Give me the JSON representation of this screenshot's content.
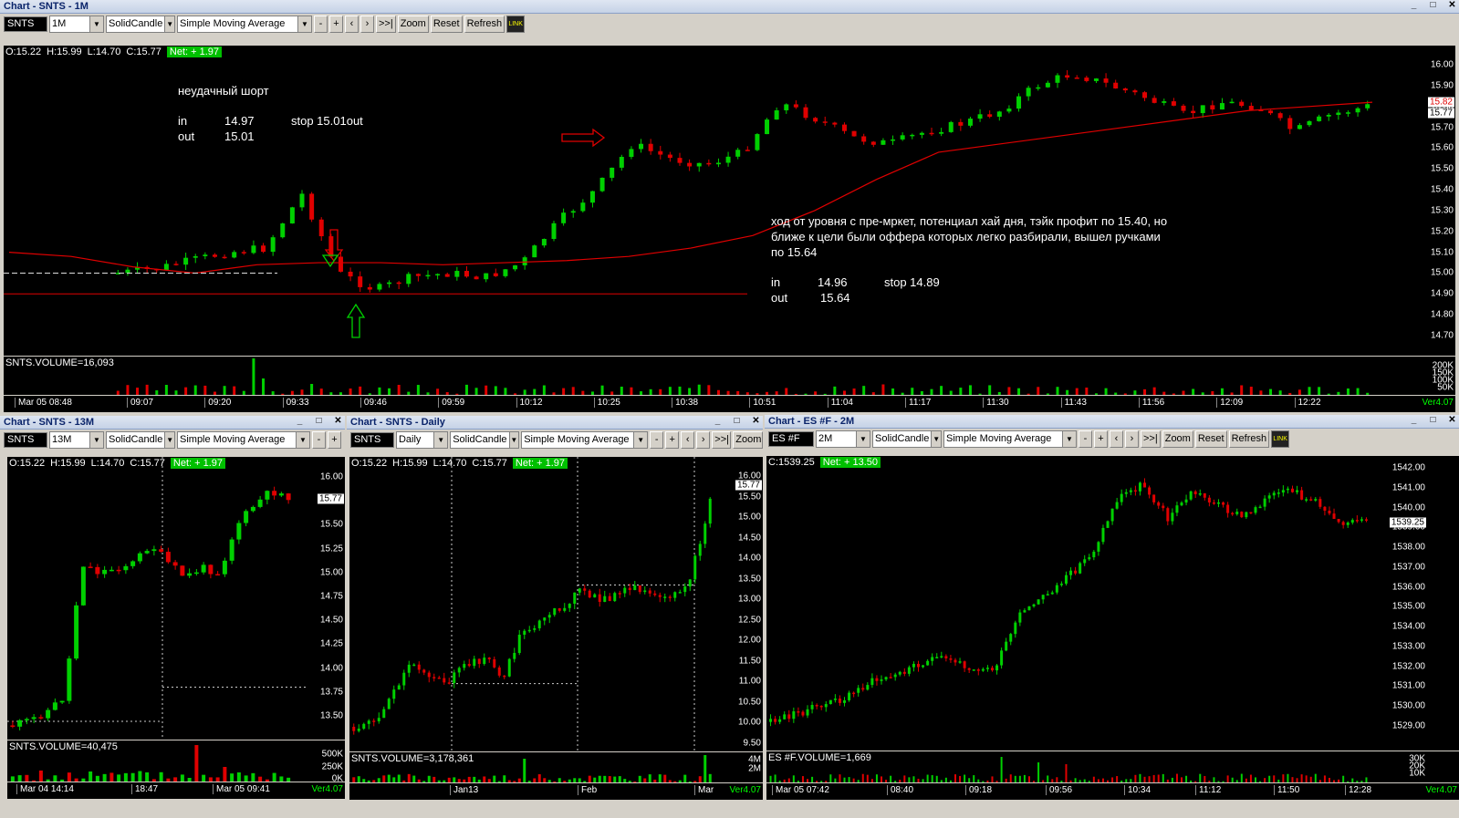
{
  "colors": {
    "up": "#00d000",
    "down": "#e00000",
    "sma": "#e00000",
    "net": "#00c000"
  },
  "top": {
    "title": "Chart - SNTS - 1M",
    "symbol": "SNTS",
    "interval": "1M",
    "candle": "SolidCandle",
    "study": "Simple Moving Average",
    "ohlc": {
      "o": "O:15.22",
      "h": "H:15.99",
      "l": "L:14.70",
      "c": "C:15.77",
      "net": "Net: + 1.97"
    },
    "price_ticks": [
      "16.00",
      "15.90",
      "15.80",
      "15.70",
      "15.60",
      "15.50",
      "15.40",
      "15.30",
      "15.20",
      "15.10",
      "15.00",
      "14.90",
      "14.80",
      "14.70"
    ],
    "last_price": "15.77",
    "sma_price": "15.82",
    "volume_label": "SNTS.VOLUME=16,093",
    "volume_ticks": [
      "200K",
      "150K",
      "100K",
      "50K"
    ],
    "time_labels": [
      "Mar 05 08:48",
      "09:07",
      "09:20",
      "09:33",
      "09:46",
      "09:59",
      "10:12",
      "10:25",
      "10:38",
      "10:51",
      "11:04",
      "11:17",
      "11:30",
      "11:43",
      "11:56",
      "12:09",
      "12:22"
    ],
    "version": "Ver4.07",
    "annotation1": {
      "title": "неудачный шорт",
      "in_label": "in",
      "in_val": "14.97",
      "stop": "stop 15.01out",
      "out_label": "out",
      "out_val": "15.01"
    },
    "annotation2": {
      "line1": "ход от уровня с пре-мркет, потенциал хай дня, тэйк профит по 15.40, но",
      "line2": "ближе к цели были оффера которых легко разбирали, вышел ручками",
      "line3": "по 15.64",
      "in_label": "in",
      "in_val": "14.96",
      "stop": "stop 14.89",
      "out_label": "out",
      "out_val": "15.64"
    }
  },
  "left": {
    "title": "Chart - SNTS - 13M",
    "symbol": "SNTS",
    "interval": "13M",
    "candle": "SolidCandle",
    "study": "Simple Moving Average",
    "ohlc": {
      "o": "O:15.22",
      "h": "H:15.99",
      "l": "L:14.70",
      "c": "C:15.77",
      "net": "Net: + 1.97"
    },
    "price_ticks": [
      "16.00",
      "15.75",
      "15.50",
      "15.25",
      "15.00",
      "14.75",
      "14.50",
      "14.25",
      "14.00",
      "13.75",
      "13.50"
    ],
    "last_price": "15.77",
    "volume_label": "SNTS.VOLUME=40,475",
    "volume_ticks": [
      "500K",
      "250K",
      "0K"
    ],
    "time_labels": [
      "Mar 04 14:14",
      "18:47",
      "Mar 05 09:41"
    ],
    "version": "Ver4.07"
  },
  "middle": {
    "title": "Chart - SNTS - Daily",
    "symbol": "SNTS",
    "interval": "Daily",
    "candle": "SolidCandle",
    "study": "Simple Moving Average",
    "ohlc": {
      "o": "O:15.22",
      "h": "H:15.99",
      "l": "L:14.70",
      "c": "C:15.77",
      "net": "Net: + 1.97"
    },
    "price_ticks": [
      "16.00",
      "15.50",
      "15.00",
      "14.50",
      "14.00",
      "13.50",
      "13.00",
      "12.50",
      "12.00",
      "11.50",
      "11.00",
      "10.50",
      "10.00",
      "9.50"
    ],
    "last_price": "15.77",
    "volume_label": "SNTS.VOLUME=3,178,361",
    "volume_ticks": [
      "4M",
      "2M"
    ],
    "time_labels": [
      "Jan13",
      "Feb",
      "Mar"
    ],
    "version": "Ver4.07"
  },
  "right": {
    "title": "Chart - ES #F - 2M",
    "symbol": "ES #F",
    "interval": "2M",
    "candle": "SolidCandle",
    "study": "Simple Moving Average",
    "ohlc": {
      "c": "C:1539.25",
      "net": "Net: + 13.50"
    },
    "price_ticks": [
      "1542.00",
      "1541.00",
      "1540.00",
      "1539.00",
      "1538.00",
      "1537.00",
      "1536.00",
      "1535.00",
      "1534.00",
      "1533.00",
      "1532.00",
      "1531.00",
      "1530.00",
      "1529.00"
    ],
    "last_price": "1539.25",
    "volume_label": "ES #F.VOLUME=1,669",
    "volume_ticks": [
      "30K",
      "20K",
      "10K"
    ],
    "time_labels": [
      "Mar 05 07:42",
      "08:40",
      "09:18",
      "09:56",
      "10:34",
      "11:12",
      "11:50",
      "12:28"
    ],
    "version": "Ver4.07"
  },
  "toolbar": {
    "minus": "-",
    "plus": "+",
    "prev": "‹",
    "next": "›",
    "end": ">>|",
    "zoom": "Zoom",
    "reset": "Reset",
    "refresh": "Refresh",
    "link": "LINK"
  }
}
